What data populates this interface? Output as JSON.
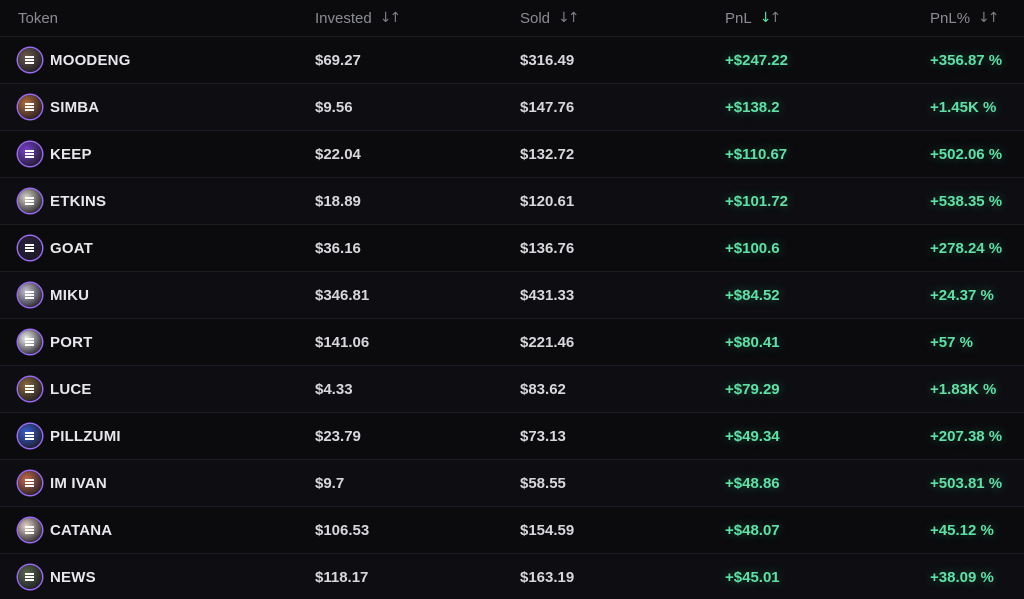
{
  "colors": {
    "background": "#0b0b0e",
    "positive": "#5fe0a6",
    "header_text": "#8b8c93",
    "avatar_ring": "#9b6cf6"
  },
  "header": {
    "token": "Token",
    "invested": "Invested",
    "sold": "Sold",
    "pnl": "PnL",
    "pnl_pct": "PnL%",
    "sort_icon": "sort-arrows-icon",
    "active_sort": "pnl"
  },
  "rows": [
    {
      "token": "MOODENG",
      "invested": "$69.27",
      "sold": "$316.49",
      "pnl": "+$247.22",
      "pnl_pct": "+356.87 %",
      "avatar": "#6b5a4a"
    },
    {
      "token": "SIMBA",
      "invested": "$9.56",
      "sold": "$147.76",
      "pnl": "+$138.2",
      "pnl_pct": "+1.45K %",
      "avatar": "#b56d3a"
    },
    {
      "token": "KEEP",
      "invested": "$22.04",
      "sold": "$132.72",
      "pnl": "+$110.67",
      "pnl_pct": "+502.06 %",
      "avatar": "#7a3fd1"
    },
    {
      "token": "ETKINS",
      "invested": "$18.89",
      "sold": "$120.61",
      "pnl": "+$101.72",
      "pnl_pct": "+538.35 %",
      "avatar": "#d9d2c6"
    },
    {
      "token": "GOAT",
      "invested": "$36.16",
      "sold": "$136.76",
      "pnl": "+$100.6",
      "pnl_pct": "+278.24 %",
      "avatar": "#2a1f3d"
    },
    {
      "token": "MIKU",
      "invested": "$346.81",
      "sold": "$431.33",
      "pnl": "+$84.52",
      "pnl_pct": "+24.37 %",
      "avatar": "#c9c4d6"
    },
    {
      "token": "PORT",
      "invested": "$141.06",
      "sold": "$221.46",
      "pnl": "+$80.41",
      "pnl_pct": "+57 %",
      "avatar": "#f0f0f0"
    },
    {
      "token": "LUCE",
      "invested": "$4.33",
      "sold": "$83.62",
      "pnl": "+$79.29",
      "pnl_pct": "+1.83K %",
      "avatar": "#8a6a3a"
    },
    {
      "token": "PILLZUMI",
      "invested": "$23.79",
      "sold": "$73.13",
      "pnl": "+$49.34",
      "pnl_pct": "+207.38 %",
      "avatar": "#3a5fd1"
    },
    {
      "token": "IM IVAN",
      "invested": "$9.7",
      "sold": "$58.55",
      "pnl": "+$48.86",
      "pnl_pct": "+503.81 %",
      "avatar": "#c46a4a"
    },
    {
      "token": "CATANA",
      "invested": "$106.53",
      "sold": "$154.59",
      "pnl": "+$48.07",
      "pnl_pct": "+45.12 %",
      "avatar": "#e8d4c8"
    },
    {
      "token": "NEWS",
      "invested": "$118.17",
      "sold": "$163.19",
      "pnl": "+$45.01",
      "pnl_pct": "+38.09 %",
      "avatar": "#5a6a4a"
    }
  ]
}
